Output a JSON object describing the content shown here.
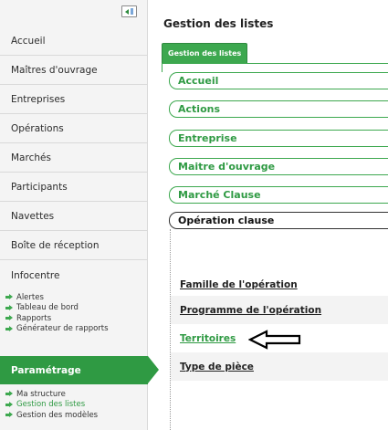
{
  "sidebar": {
    "nav": [
      {
        "label": "Accueil"
      },
      {
        "label": "Maîtres d'ouvrage"
      },
      {
        "label": "Entreprises"
      },
      {
        "label": "Opérations"
      },
      {
        "label": "Marchés"
      },
      {
        "label": "Participants"
      },
      {
        "label": "Navettes"
      },
      {
        "label": "Boîte de réception"
      },
      {
        "label": "Infocentre"
      }
    ],
    "infocentre_sub": [
      {
        "label": "Alertes"
      },
      {
        "label": "Tableau de bord"
      },
      {
        "label": "Rapports"
      },
      {
        "label": "Générateur de rapports"
      }
    ],
    "active": {
      "label": "Paramétrage"
    },
    "parametrage_sub": [
      {
        "label": "Ma structure"
      },
      {
        "label": "Gestion des listes"
      },
      {
        "label": "Gestion des modèles"
      }
    ]
  },
  "main": {
    "title": "Gestion des listes",
    "tab": "Gestion des listes",
    "categories": [
      {
        "label": "Accueil"
      },
      {
        "label": "Actions"
      },
      {
        "label": "Entreprise"
      },
      {
        "label": "Maitre d'ouvrage"
      },
      {
        "label": "Marché Clause"
      },
      {
        "label": "Opération clause"
      }
    ],
    "items": [
      {
        "label": "Famille de l'opération"
      },
      {
        "label": "Programme de l'opération"
      },
      {
        "label": "Territoires"
      },
      {
        "label": "Type de pièce"
      }
    ]
  },
  "colors": {
    "accent": "#3da84f",
    "active_nav": "#2f9a43"
  }
}
